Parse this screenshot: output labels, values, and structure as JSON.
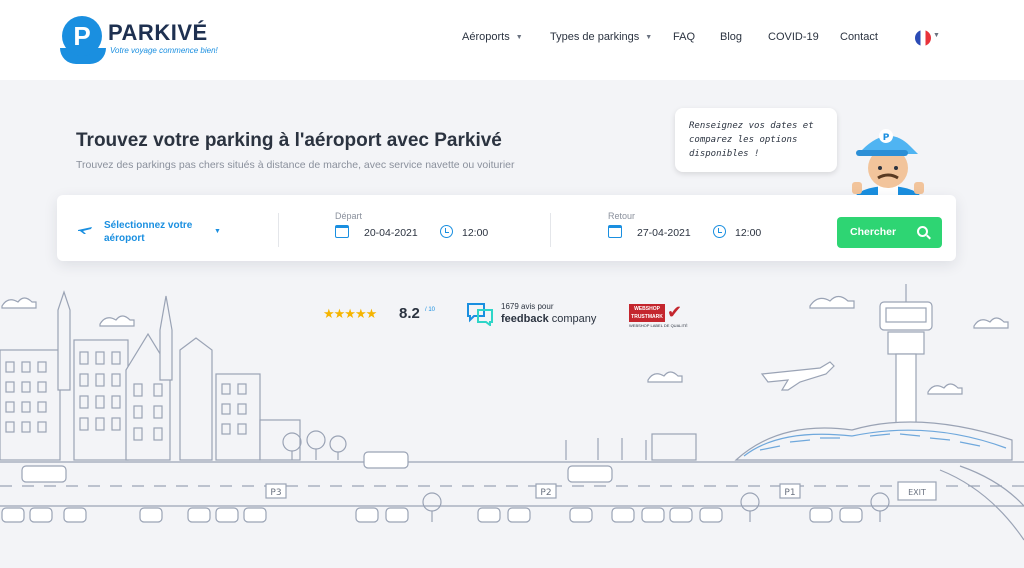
{
  "header": {
    "brand": "PARKIVÉ",
    "tagline": "Votre voyage commence bien!",
    "logo_letter": "P",
    "nav": [
      {
        "label": "Aéroports",
        "has_dropdown": true
      },
      {
        "label": "Types de parkings",
        "has_dropdown": true
      },
      {
        "label": "FAQ",
        "has_dropdown": false
      },
      {
        "label": "Blog",
        "has_dropdown": false
      },
      {
        "label": "COVID-19",
        "has_dropdown": false
      },
      {
        "label": "Contact",
        "has_dropdown": false
      }
    ],
    "language_icon": "france-flag-icon"
  },
  "hero": {
    "title": "Trouvez votre parking à l'aéroport avec Parkivé",
    "subtitle": "Trouvez des parkings pas chers situés à distance de marche, avec service navette ou voiturier",
    "speech_bubble": "Renseignez vos dates et comparez les options disponibles !"
  },
  "search": {
    "airport_placeholder": "Sélectionnez votre aéroport",
    "departure_label": "Départ",
    "departure_date": "20-04-2021",
    "departure_time": "12:00",
    "return_label": "Retour",
    "return_date": "27-04-2021",
    "return_time": "12:00",
    "button_label": "Chercher"
  },
  "trust": {
    "stars": "★★★★★",
    "rating_value": 4.5,
    "rating": "8.2",
    "rating_max": "/ 10",
    "feedback_count": "1679 avis pour",
    "feedback_brand_bold": "feedback",
    "feedback_brand_rest": " company",
    "webshop_badge": "WEBSHOP TRUSTMARK",
    "webshop_caption": "WEBSHOP LABEL DE QUALITÉ"
  },
  "illustration": {
    "parking_signs": [
      "P3",
      "P2",
      "P1"
    ],
    "exit_sign": "EXIT"
  },
  "colors": {
    "accent": "#1a8fe0",
    "button": "#2ed573",
    "star": "#f5b400",
    "line": "#9aa3b5"
  }
}
